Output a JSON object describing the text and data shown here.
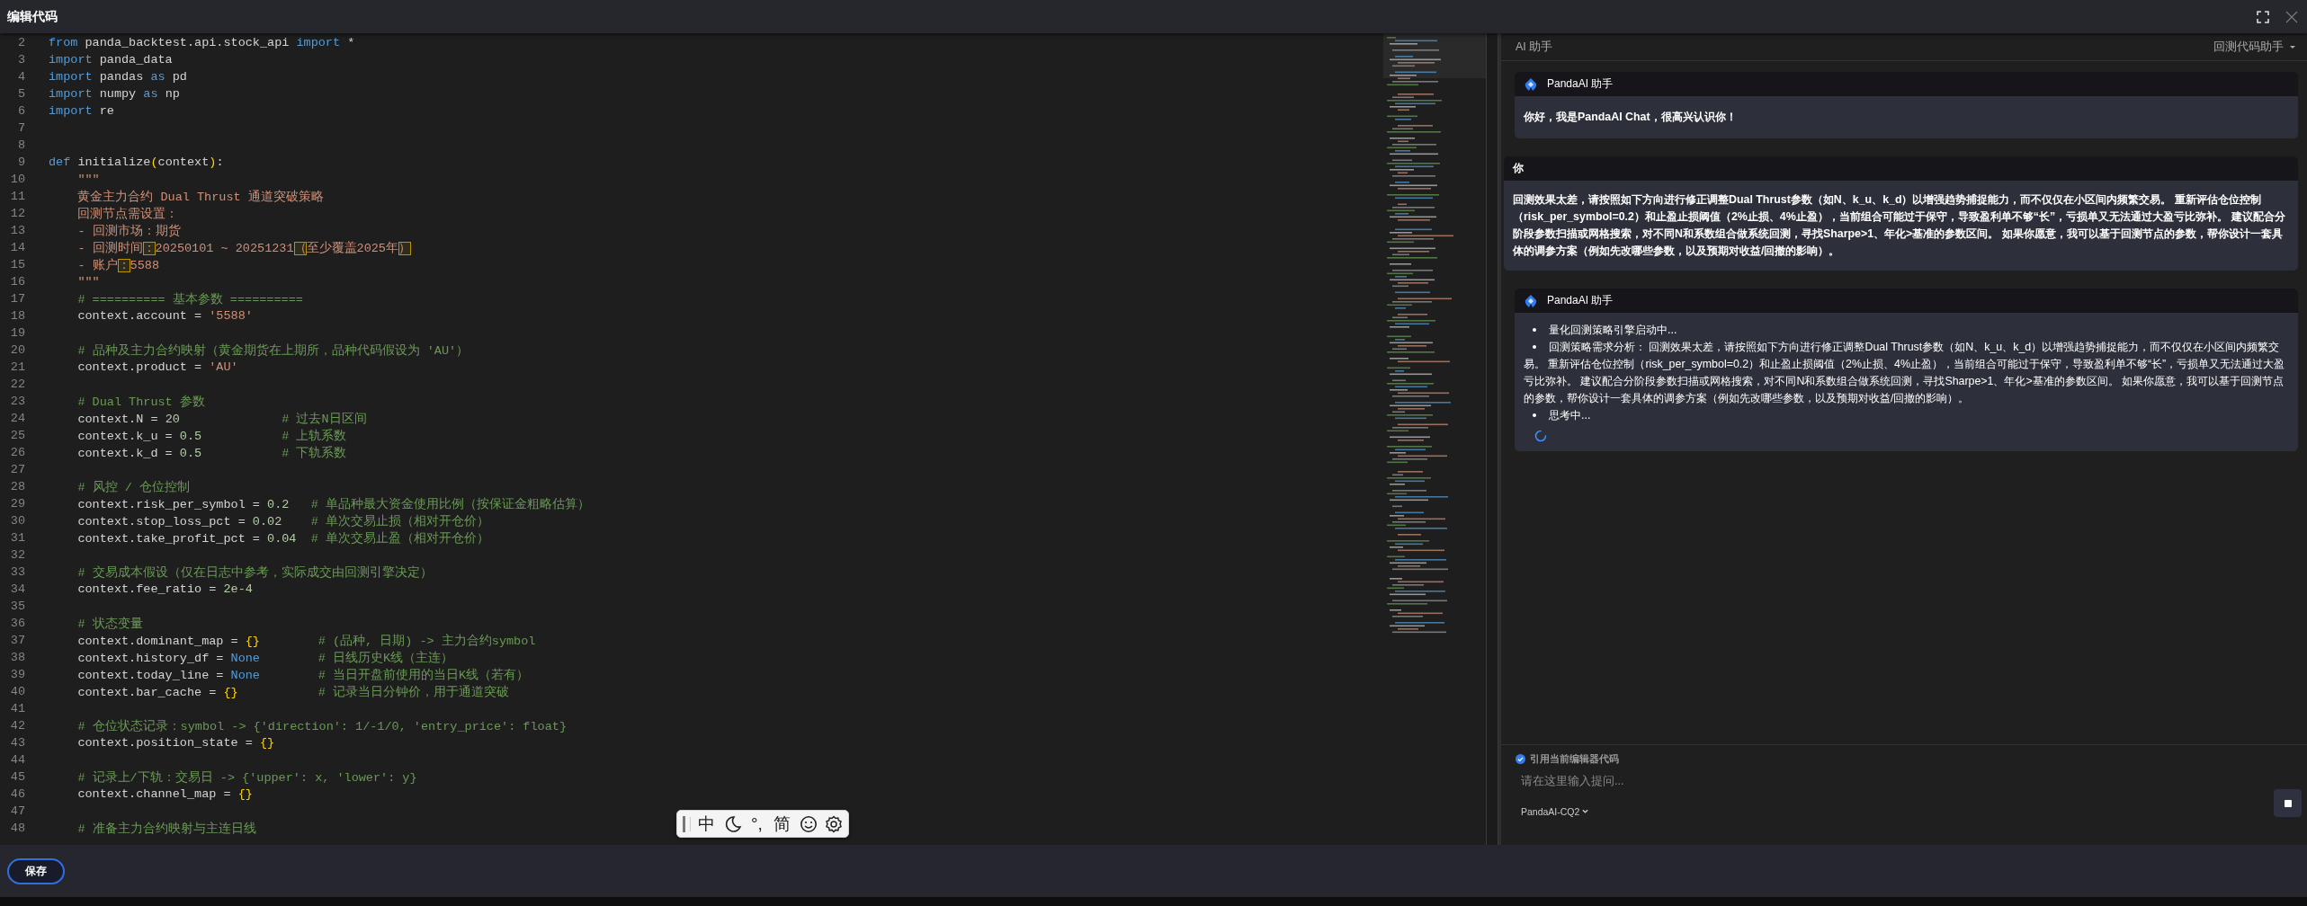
{
  "window": {
    "title": "编辑代码"
  },
  "editor": {
    "lines": [
      {
        "number": "2",
        "tokens": [
          {
            "kind": "kw",
            "text": "from"
          },
          {
            "kind": "id",
            "text": " panda_backtest.api.stock_api "
          },
          {
            "kind": "kw",
            "text": "import"
          },
          {
            "kind": "id",
            "text": " *"
          }
        ]
      },
      {
        "number": "3",
        "tokens": [
          {
            "kind": "kw",
            "text": "import"
          },
          {
            "kind": "id",
            "text": " panda_data"
          }
        ]
      },
      {
        "number": "4",
        "tokens": [
          {
            "kind": "kw",
            "text": "import"
          },
          {
            "kind": "id",
            "text": " pandas "
          },
          {
            "kind": "kw",
            "text": "as"
          },
          {
            "kind": "id",
            "text": " pd"
          }
        ]
      },
      {
        "number": "5",
        "tokens": [
          {
            "kind": "kw",
            "text": "import"
          },
          {
            "kind": "id",
            "text": " numpy "
          },
          {
            "kind": "kw",
            "text": "as"
          },
          {
            "kind": "id",
            "text": " np"
          }
        ]
      },
      {
        "number": "6",
        "tokens": [
          {
            "kind": "kw",
            "text": "import"
          },
          {
            "kind": "id",
            "text": " re"
          }
        ]
      },
      {
        "number": "7"
      },
      {
        "number": "8"
      },
      {
        "number": "9",
        "tokens": [
          {
            "kind": "kw",
            "text": "def"
          },
          {
            "kind": "id",
            "text": " initialize"
          },
          {
            "kind": "br",
            "text": "("
          },
          {
            "kind": "id",
            "text": "context"
          },
          {
            "kind": "br",
            "text": ")"
          },
          {
            "kind": "id",
            "text": ":"
          }
        ]
      },
      {
        "number": "10",
        "tokens": [
          {
            "kind": "str",
            "text": "    \"\"\""
          }
        ]
      },
      {
        "number": "11",
        "tokens": [
          {
            "kind": "str",
            "text": "    黄金主力合约 Dual Thrust 通道突破策略"
          }
        ]
      },
      {
        "number": "12",
        "tokens": [
          {
            "kind": "str",
            "text": "    回测节点需设置："
          }
        ]
      },
      {
        "number": "13",
        "tokens": [
          {
            "kind": "str",
            "text": "    - 回测市场：期货"
          }
        ]
      },
      {
        "number": "14",
        "tokens": [
          {
            "kind": "str",
            "text": "    - 回测时间"
          },
          {
            "kind": "flag",
            "text": "："
          },
          {
            "kind": "str",
            "text": "20250101 ~ 20251231"
          },
          {
            "kind": "flag",
            "text": "（"
          },
          {
            "kind": "str",
            "text": "至少覆盖2025年"
          },
          {
            "kind": "flag",
            "text": "）"
          }
        ]
      },
      {
        "number": "15",
        "tokens": [
          {
            "kind": "str",
            "text": "    - 账户"
          },
          {
            "kind": "flag",
            "text": "："
          },
          {
            "kind": "str",
            "text": "5588"
          }
        ]
      },
      {
        "number": "16",
        "tokens": [
          {
            "kind": "str",
            "text": "    \"\"\""
          }
        ]
      },
      {
        "number": "17",
        "tokens": [
          {
            "kind": "cm",
            "text": "    # ========== 基本参数 =========="
          }
        ]
      },
      {
        "number": "18",
        "tokens": [
          {
            "kind": "id",
            "text": "    context.account = "
          },
          {
            "kind": "str",
            "text": "'5588'"
          }
        ]
      },
      {
        "number": "19"
      },
      {
        "number": "20",
        "tokens": [
          {
            "kind": "cm",
            "text": "    # 品种及主力合约映射（黄金期货在上期所，品种代码假设为 'AU'）"
          }
        ]
      },
      {
        "number": "21",
        "tokens": [
          {
            "kind": "id",
            "text": "    context.product = "
          },
          {
            "kind": "str",
            "text": "'AU'"
          }
        ]
      },
      {
        "number": "22"
      },
      {
        "number": "23",
        "tokens": [
          {
            "kind": "cm",
            "text": "    # Dual Thrust 参数"
          }
        ]
      },
      {
        "number": "24",
        "tokens": [
          {
            "kind": "id",
            "text": "    context.N = "
          },
          {
            "kind": "num",
            "text": "20"
          },
          {
            "kind": "cm",
            "text": "              # 过去N日区间"
          }
        ]
      },
      {
        "number": "25",
        "tokens": [
          {
            "kind": "id",
            "text": "    context.k_u = "
          },
          {
            "kind": "num",
            "text": "0.5"
          },
          {
            "kind": "cm",
            "text": "           # 上轨系数"
          }
        ]
      },
      {
        "number": "26",
        "tokens": [
          {
            "kind": "id",
            "text": "    context.k_d = "
          },
          {
            "kind": "num",
            "text": "0.5"
          },
          {
            "kind": "cm",
            "text": "           # 下轨系数"
          }
        ]
      },
      {
        "number": "27"
      },
      {
        "number": "28",
        "tokens": [
          {
            "kind": "cm",
            "text": "    # 风控 / 仓位控制"
          }
        ]
      },
      {
        "number": "29",
        "tokens": [
          {
            "kind": "id",
            "text": "    context.risk_per_symbol = "
          },
          {
            "kind": "num",
            "text": "0.2"
          },
          {
            "kind": "cm",
            "text": "   # 单品种最大资金使用比例（按保证金粗略估算）"
          }
        ]
      },
      {
        "number": "30",
        "tokens": [
          {
            "kind": "id",
            "text": "    context.stop_loss_pct = "
          },
          {
            "kind": "num",
            "text": "0.02"
          },
          {
            "kind": "cm",
            "text": "    # 单次交易止损（相对开仓价）"
          }
        ]
      },
      {
        "number": "31",
        "tokens": [
          {
            "kind": "id",
            "text": "    context.take_profit_pct = "
          },
          {
            "kind": "num",
            "text": "0.04"
          },
          {
            "kind": "cm",
            "text": "  # 单次交易止盈（相对开仓价）"
          }
        ]
      },
      {
        "number": "32"
      },
      {
        "number": "33",
        "tokens": [
          {
            "kind": "cm",
            "text": "    # 交易成本假设（仅在日志中参考，实际成交由回测引擎决定）"
          }
        ]
      },
      {
        "number": "34",
        "tokens": [
          {
            "kind": "id",
            "text": "    context.fee_ratio = "
          },
          {
            "kind": "num",
            "text": "2e-4"
          }
        ]
      },
      {
        "number": "35"
      },
      {
        "number": "36",
        "tokens": [
          {
            "kind": "cm",
            "text": "    # 状态变量"
          }
        ]
      },
      {
        "number": "37",
        "tokens": [
          {
            "kind": "id",
            "text": "    context.dominant_map = "
          },
          {
            "kind": "br",
            "text": "{}"
          },
          {
            "kind": "cm",
            "text": "        # (品种, 日期) -> 主力合约symbol"
          }
        ]
      },
      {
        "number": "38",
        "tokens": [
          {
            "kind": "id",
            "text": "    context.history_df = "
          },
          {
            "kind": "kw",
            "text": "None"
          },
          {
            "kind": "cm",
            "text": "        # 日线历史K线（主连）"
          }
        ]
      },
      {
        "number": "39",
        "tokens": [
          {
            "kind": "id",
            "text": "    context.today_line = "
          },
          {
            "kind": "kw",
            "text": "None"
          },
          {
            "kind": "cm",
            "text": "        # 当日开盘前使用的当日K线（若有）"
          }
        ]
      },
      {
        "number": "40",
        "tokens": [
          {
            "kind": "id",
            "text": "    context.bar_cache = "
          },
          {
            "kind": "br",
            "text": "{}"
          },
          {
            "kind": "cm",
            "text": "           # 记录当日分钟价，用于通道突破"
          }
        ]
      },
      {
        "number": "41"
      },
      {
        "number": "42",
        "tokens": [
          {
            "kind": "cm",
            "text": "    # 仓位状态记录：symbol -> {'direction': 1/-1/0, 'entry_price': float}"
          }
        ]
      },
      {
        "number": "43",
        "tokens": [
          {
            "kind": "id",
            "text": "    context.position_state = "
          },
          {
            "kind": "br",
            "text": "{}"
          }
        ]
      },
      {
        "number": "44"
      },
      {
        "number": "45",
        "tokens": [
          {
            "kind": "cm",
            "text": "    # 记录上/下轨：交易日 -> {'upper': x, 'lower': y}"
          }
        ]
      },
      {
        "number": "46",
        "tokens": [
          {
            "kind": "id",
            "text": "    context.channel_map = "
          },
          {
            "kind": "br",
            "text": "{}"
          }
        ]
      },
      {
        "number": "47"
      },
      {
        "number": "48",
        "tokens": [
          {
            "kind": "cm",
            "text": "    # 准备主力合约映射与主连日线"
          }
        ]
      }
    ]
  },
  "ime_toolbar": {
    "items": [
      {
        "kind": "cursor"
      },
      {
        "kind": "text",
        "text": "中"
      },
      {
        "kind": "moon"
      },
      {
        "kind": "text",
        "text": "°,"
      },
      {
        "kind": "text",
        "text": "简"
      },
      {
        "kind": "smiley"
      },
      {
        "kind": "gear"
      }
    ]
  },
  "assistant_panel": {
    "title": "AI 助手",
    "mode": "回测代码助手",
    "messages": [
      {
        "author": "PandaAI 助手",
        "kind": "assistant_text",
        "text": "你好，我是PandaAI Chat，很高兴认识你！"
      },
      {
        "author": "你",
        "kind": "user_text",
        "text": "回测效果太差，请按照如下方向进行修正调整Dual Thrust参数（如N、k_u、k_d）以增强趋势捕捉能力，而不仅仅在小区间内频繁交易。 重新评估仓位控制（risk_per_symbol=0.2）和止盈止损阈值（2%止损、4%止盈），当前组合可能过于保守，导致盈利单不够“长”，亏损单又无法通过大盈亏比弥补。 建议配合分阶段参数扫描或网格搜索，对不同N和系数组合做系统回测，寻找Sharpe>1、年化>基准的参数区间。 如果你愿意，我可以基于回测节点的参数，帮你设计一套具体的调参方案（例如先改哪些参数，以及预期对收益/回撤的影响）。"
      },
      {
        "author": "PandaAI 助手",
        "kind": "assistant_steps",
        "loading": true,
        "items": [
          "量化回测策略引擎启动中...",
          "回测策略需求分析： 回测效果太差，请按照如下方向进行修正调整Dual Thrust参数（如N、k_u、k_d）以增强趋势捕捉能力，而不仅仅在小区间内频繁交易。 重新评估仓位控制（risk_per_symbol=0.2）和止盈止损阈值（2%止损、4%止盈），当前组合可能过于保守，导致盈利单不够“长”，亏损单又无法通过大盈亏比弥补。 建议配合分阶段参数扫描或网格搜索，对不同N和系数组合做系统回测，寻找Sharpe>1、年化>基准的参数区间。 如果你愿意，我可以基于回测节点的参数，帮你设计一套具体的调参方案（例如先改哪些参数，以及预期对收益/回撤的影响）。",
          "思考中..."
        ]
      }
    ],
    "composer": {
      "reference": {
        "label": "引用当前编辑器代码",
        "checked": true
      },
      "placeholder": "请在这里输入提问...",
      "model": "PandaAI-CQ2"
    }
  },
  "footer": {
    "save_button": "保存"
  }
}
